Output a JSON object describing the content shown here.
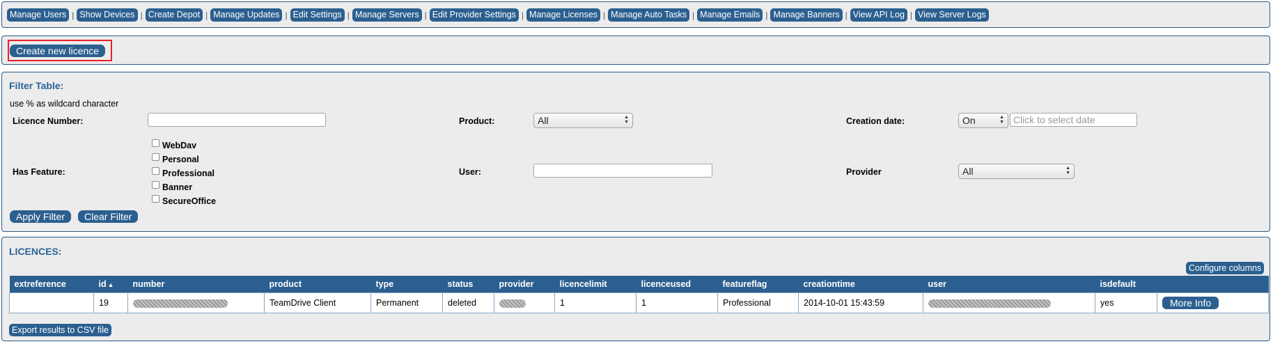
{
  "nav": {
    "items": [
      "Manage Users",
      "Show Devices",
      "Create Depot",
      "Manage Updates",
      "Edit Settings",
      "Manage Servers",
      "Edit Provider Settings",
      "Manage Licenses",
      "Manage Auto Tasks",
      "Manage Emails",
      "Manage Banners",
      "View API Log",
      "View Server Logs"
    ],
    "separator": "|"
  },
  "create": {
    "label": "Create new licence"
  },
  "filter": {
    "title": "Filter Table:",
    "hint": "use % as wildcard character",
    "licence_number_label": "Licence Number:",
    "product_label": "Product:",
    "product_value": "All",
    "creation_date_label": "Creation date:",
    "creation_date_mode": "On",
    "creation_date_placeholder": "Click to select date",
    "has_feature_label": "Has Feature:",
    "features": [
      "WebDav",
      "Personal",
      "Professional",
      "Banner",
      "SecureOffice"
    ],
    "user_label": "User:",
    "provider_label": "Provider",
    "provider_value": "All",
    "apply_label": "Apply Filter",
    "clear_label": "Clear Filter"
  },
  "licences": {
    "title": "LICENCES:",
    "configure_label": "Configure columns",
    "columns": [
      "extreference",
      "id",
      "number",
      "product",
      "type",
      "status",
      "provider",
      "licencelimit",
      "licenceused",
      "featureflag",
      "creationtime",
      "user",
      "isdefault",
      ""
    ],
    "sort_icon": "triangle-up-icon",
    "row": {
      "extreference": "",
      "id": "19",
      "product": "TeamDrive Client",
      "type": "Permanent",
      "status": "deleted",
      "licencelimit": "1",
      "licenceused": "1",
      "featureflag": "Professional",
      "creationtime": "2014-10-01 15:43:59",
      "isdefault": "yes"
    },
    "more_info_label": "More Info",
    "export_label": "Export results to CSV file"
  },
  "colors": {
    "accent": "#2b5f8f",
    "highlight": "#e8202a",
    "title": "#2a6496"
  }
}
